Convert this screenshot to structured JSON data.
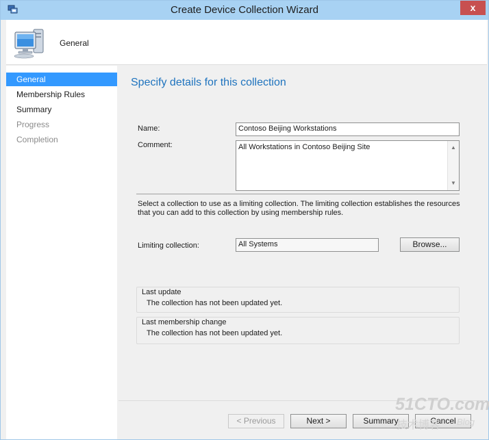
{
  "window": {
    "title": "Create Device Collection Wizard",
    "close_glyph": "x"
  },
  "header": {
    "title": "General",
    "icon": "computer-monitor-icon"
  },
  "nav": {
    "items": [
      {
        "label": "General",
        "state": "selected"
      },
      {
        "label": "Membership Rules",
        "state": "enabled"
      },
      {
        "label": "Summary",
        "state": "enabled"
      },
      {
        "label": "Progress",
        "state": "disabled"
      },
      {
        "label": "Completion",
        "state": "disabled"
      }
    ]
  },
  "content": {
    "heading": "Specify details for this collection",
    "name_label": "Name:",
    "name_value": "Contoso Beijing Workstations",
    "comment_label": "Comment:",
    "comment_value": "All Workstations in Contoso Beijing Site",
    "limiting_info": "Select a collection to use as a limiting collection. The limiting collection establishes the resources that you can add to this collection by using membership rules.",
    "limiting_label": "Limiting collection:",
    "limiting_value": "All Systems",
    "browse_label": "Browse...",
    "last_update": {
      "title": "Last update",
      "text": "The collection has not been updated yet."
    },
    "last_membership_change": {
      "title": "Last membership change",
      "text": "The collection has not been updated yet."
    }
  },
  "footer": {
    "previous_label": "< Previous",
    "next_label": "Next >",
    "summary_label": "Summary",
    "cancel_label": "Cancel"
  },
  "watermark": {
    "main": "51CTO.com",
    "sub": "技术博客",
    "blog": "Blog"
  },
  "colors": {
    "titlebar": "#a8d2f3",
    "accent": "#1e73be",
    "selected": "#3399ff",
    "close": "#c75050"
  }
}
